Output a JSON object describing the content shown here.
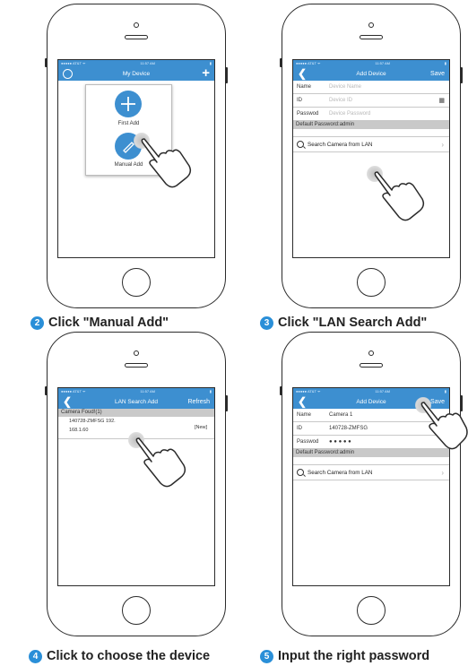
{
  "steps": [
    {
      "number": "2",
      "caption": "Click \"Manual Add\""
    },
    {
      "number": "3",
      "caption": "Click \"LAN Search Add\""
    },
    {
      "number": "4",
      "caption": "Click to choose the device"
    },
    {
      "number": "5",
      "caption": "Input the right password"
    }
  ],
  "status": {
    "carrier": "●●●●● AT&T ᯤ",
    "time": "11:57 AM",
    "battery": "▮"
  },
  "s1": {
    "title": "My Device",
    "first_add": "First Add",
    "manual_add": "Manual Add"
  },
  "s2": {
    "back": "❮",
    "title": "Add Device",
    "save": "Save",
    "name_label": "Name",
    "name_ph": "Device Name",
    "id_label": "ID",
    "id_ph": "Device ID",
    "pw_label": "Passwod",
    "pw_ph": "Device Password",
    "default_pw": "Default Password:admin",
    "search": "Search Camera from LAN",
    "chev": "›",
    "qr": "▦"
  },
  "s3": {
    "back": "❮",
    "title": "LAN Search Add",
    "refresh": "Refresh",
    "found": "Camera Foud!(1)",
    "device_line1": "140728-ZMFSG 192.",
    "device_line2": "168.1.60",
    "tag": "[New]"
  },
  "s4": {
    "back": "❮",
    "title": "Add Device",
    "save": "Save",
    "name_label": "Name",
    "name_val": "Camera  1",
    "id_label": "ID",
    "id_val": "140728-ZMFSG",
    "pw_label": "Passwod",
    "pw_val": "● ● ● ● ●",
    "default_pw": "Default Password:admin",
    "search": "Search Camera from LAN",
    "chev": "›",
    "qr": "▦"
  }
}
